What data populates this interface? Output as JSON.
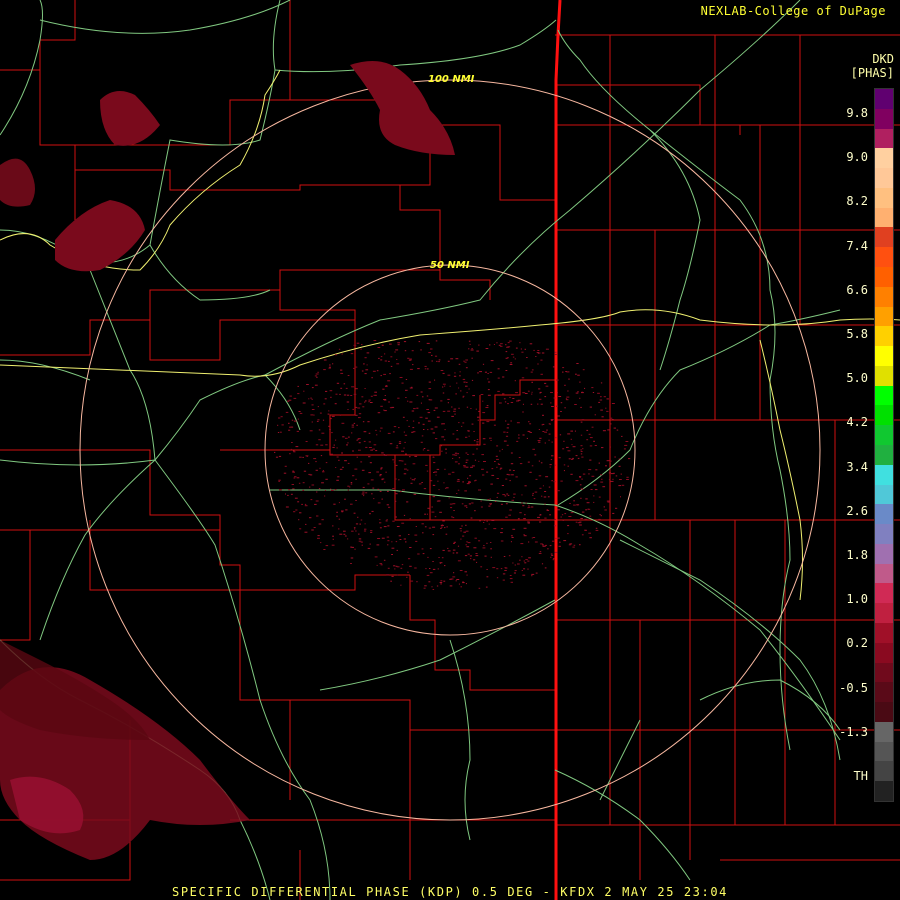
{
  "credit": "NEXLAB-College of DuPage",
  "footer": "SPECIFIC DIFFERENTIAL PHASE (KDP) 0.5 DEG - KFDX 2 MAY 25 23:04",
  "colorbar": {
    "title": "DKD",
    "unit": "[PHAS]",
    "ticks": [
      "9.8",
      "9.0",
      "8.2",
      "7.4",
      "6.6",
      "5.8",
      "5.0",
      "4.2",
      "3.4",
      "2.6",
      "1.8",
      "1.0",
      "0.2",
      "-0.5",
      "-1.3",
      "TH"
    ],
    "colors": [
      "#222222",
      "#444444",
      "#555555",
      "#666666",
      "#4a0a14",
      "#5a0a18",
      "#700a1c",
      "#8a0a20",
      "#a01028",
      "#c02040",
      "#d02a55",
      "#c05a8a",
      "#a070b0",
      "#8080c0",
      "#6a8ac8",
      "#50c8d8",
      "#40e0e0",
      "#20b040",
      "#10c830",
      "#00e000",
      "#00ff00",
      "#e0e000",
      "#ffff00",
      "#ffd000",
      "#ffa000",
      "#ff8000",
      "#ff6000",
      "#ff5010",
      "#e04020",
      "#ffb070",
      "#ffc080",
      "#ffc898",
      "#ffd0a0",
      "#b02060",
      "#800060",
      "#600070"
    ],
    "tick_color": "#ffffcc"
  },
  "rings": [
    {
      "label": "50 NMI"
    },
    {
      "label": "100 NMI"
    }
  ],
  "colors": {
    "county_lines": "#e01010",
    "highways": "#8fd08f",
    "interstate": "#ffff66",
    "rings": "#ffc0a0",
    "echo_kdp": "#8a0a20",
    "state_line": "#ff1010"
  }
}
